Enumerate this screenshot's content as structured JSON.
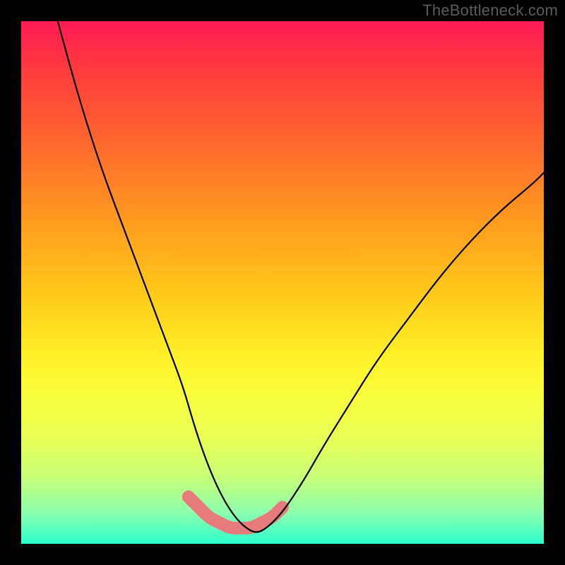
{
  "watermark": "TheBottleneck.com",
  "chart_data": {
    "type": "line",
    "title": "",
    "xlabel": "",
    "ylabel": "",
    "xlim": [
      0,
      100
    ],
    "ylim": [
      0,
      100
    ],
    "series": [
      {
        "name": "bottleneck-curve",
        "x": [
          7,
          10,
          13,
          16,
          19,
          22,
          25,
          28,
          31,
          33,
          35,
          37,
          39,
          41,
          43,
          45,
          47,
          50,
          54,
          58,
          63,
          68,
          74,
          80,
          86,
          92,
          98,
          100
        ],
        "y": [
          100,
          89,
          79,
          70,
          62,
          54,
          46,
          38,
          30,
          23,
          17,
          12,
          8,
          5,
          3,
          2,
          3,
          6,
          12,
          19,
          27,
          35,
          43,
          51,
          58,
          64,
          69,
          71
        ]
      },
      {
        "name": "highlight-band",
        "x": [
          32,
          34,
          36,
          38,
          40,
          42,
          44,
          46,
          48,
          50
        ],
        "y": [
          9,
          7,
          5,
          4,
          3,
          3,
          3,
          4,
          5,
          7
        ]
      }
    ],
    "colors": {
      "curve": "#000000",
      "highlight": "#e77b7b",
      "background_top": "#ff1a54",
      "background_bottom": "#2dffcf"
    }
  }
}
